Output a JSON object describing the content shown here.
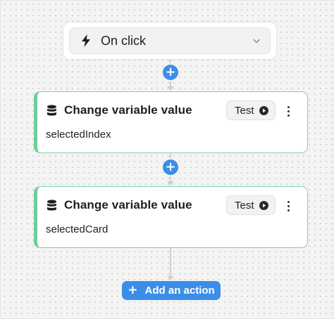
{
  "trigger": {
    "icon": "lightning-bolt-icon",
    "label": "On click",
    "dropdown_icon": "chevron-down-icon"
  },
  "insert_step_icon": "plus-icon",
  "actions": [
    {
      "icon": "database-icon",
      "title": "Change variable value",
      "variable": "selectedIndex",
      "test_label": "Test",
      "test_icon": "play-circle-icon",
      "menu_icon": "more-vertical-icon"
    },
    {
      "icon": "database-icon",
      "title": "Change variable value",
      "variable": "selectedCard",
      "test_label": "Test",
      "test_icon": "play-circle-icon",
      "menu_icon": "more-vertical-icon"
    }
  ],
  "add_action": {
    "icon": "plus-icon",
    "label": "Add an action"
  },
  "colors": {
    "accent": "#3b8ee8",
    "card_border": "#7dd3a3",
    "card_accent": "#6fce97",
    "canvas_bg": "#f4f4f4",
    "connector": "#cfcfcf"
  }
}
